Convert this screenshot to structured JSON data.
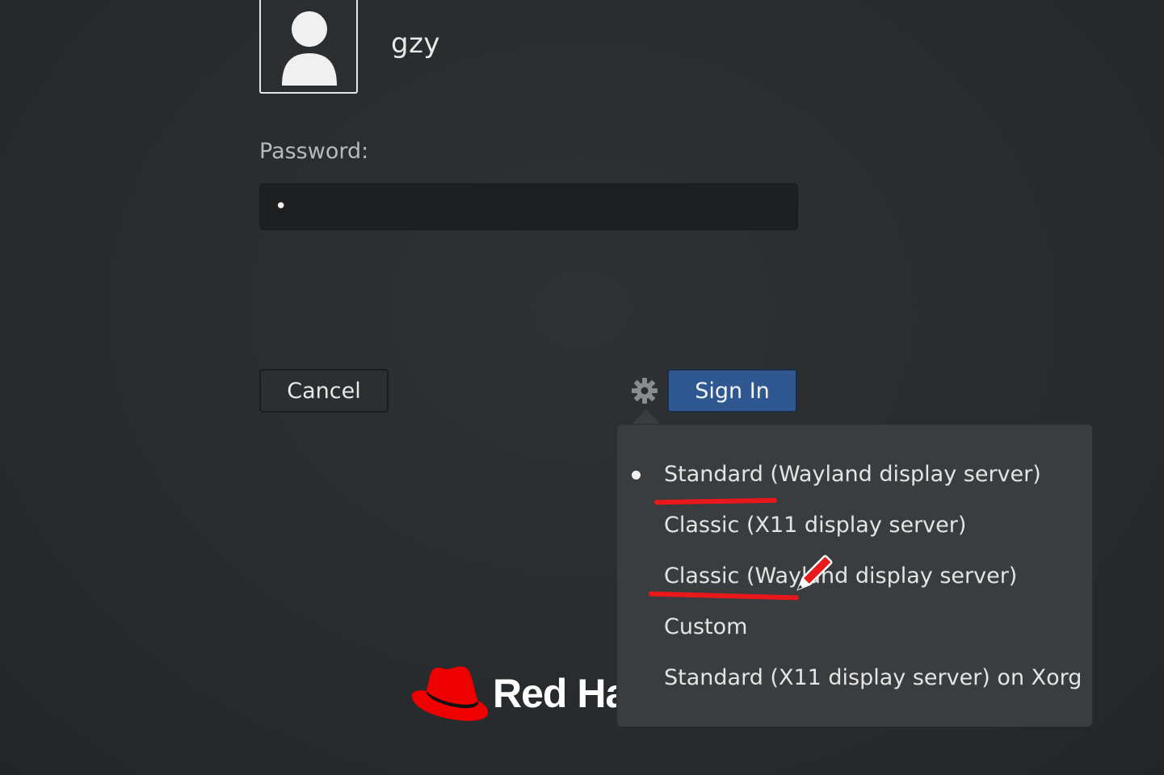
{
  "user": {
    "name": "gzy"
  },
  "login": {
    "password_label": "Password:",
    "password_value": "•",
    "cancel_label": "Cancel",
    "signin_label": "Sign In"
  },
  "sessions": {
    "items": [
      {
        "label": "Standard (Wayland display server)",
        "selected": true
      },
      {
        "label": "Classic (X11 display server)",
        "selected": false
      },
      {
        "label": "Classic (Wayland display server)",
        "selected": false
      },
      {
        "label": "Custom",
        "selected": false
      },
      {
        "label": "Standard (X11 display server) on Xorg",
        "selected": false
      }
    ]
  },
  "branding": {
    "logo_text": "Red Hat",
    "hat_color": "#ee0000"
  },
  "colors": {
    "accent": "#2f5890",
    "annotation": "#e8181b",
    "background": "#2a2d30"
  },
  "icons": {
    "avatar": "user-silhouette-icon",
    "settings": "gear-icon",
    "annotation": "pencil-icon"
  }
}
